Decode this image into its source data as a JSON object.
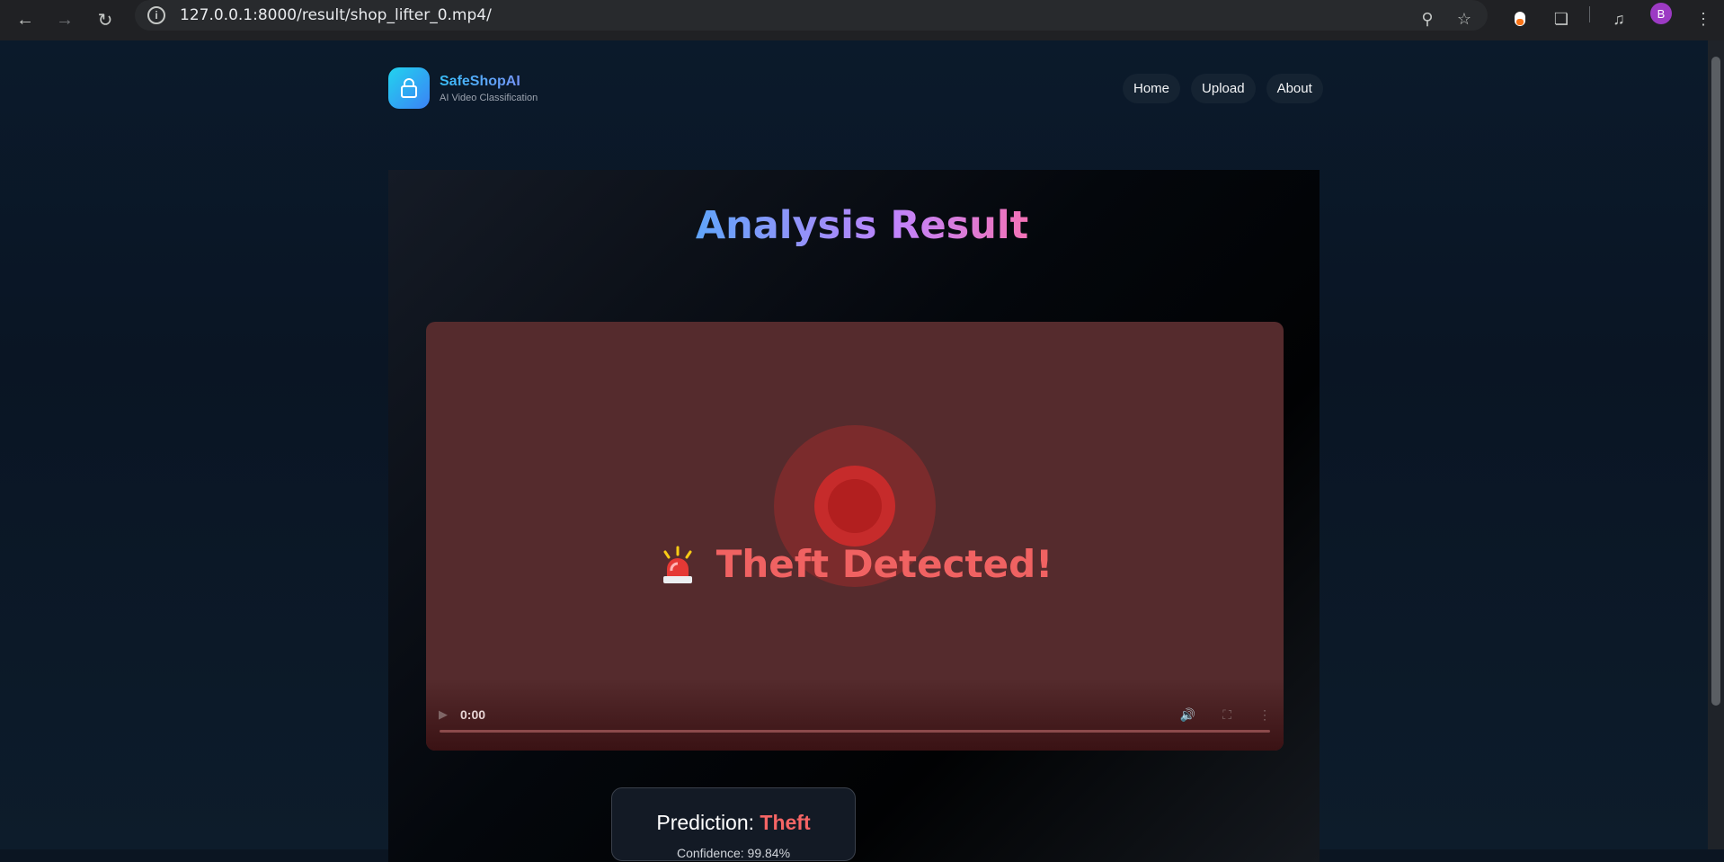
{
  "browser": {
    "url": "127.0.0.1:8000/result/shop_lifter_0.mp4/",
    "profile_initial": "B"
  },
  "brand": {
    "name": "SafeShopAI",
    "tagline": "AI Video Classification"
  },
  "nav": {
    "items": [
      {
        "label": "Home"
      },
      {
        "label": "Upload"
      },
      {
        "label": "About"
      }
    ]
  },
  "main": {
    "title": "Analysis Result"
  },
  "video": {
    "alert_text": "Theft Detected!",
    "current_time": "0:00"
  },
  "prediction": {
    "label": "Prediction:",
    "value": "Theft",
    "confidence_text": "Confidence: 99.84%"
  },
  "colors": {
    "accent": "#3b82f6",
    "alert": "#f06262"
  }
}
